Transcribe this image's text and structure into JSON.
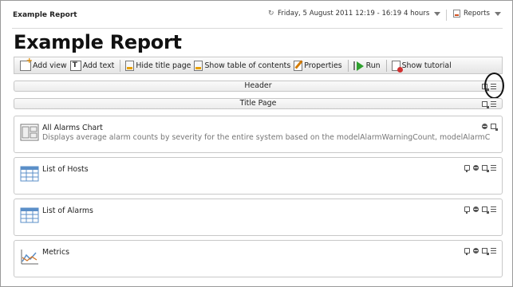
{
  "topbar": {
    "title": "Example Report",
    "time_range": "Friday, 5 August 2011 12:19 - 16:19 4 hours",
    "time_icon": "refresh-clock-icon",
    "reports_label": "Reports",
    "reports_icon": "reports-icon"
  },
  "page": {
    "title": "Example Report"
  },
  "toolbar": {
    "add_view": "Add view",
    "add_text": "Add text",
    "hide_title_page": "Hide title page",
    "show_toc": "Show table of contents",
    "properties": "Properties",
    "run": "Run",
    "show_tutorial": "Show tutorial"
  },
  "sections": {
    "header": "Header",
    "title_page": "Title Page"
  },
  "views": [
    {
      "title": "All Alarms Chart",
      "description": "Displays average alarm counts by severity for the entire system based on the modelAlarmWarningCount, modelAlarmC",
      "icon": "dashboard-layout-icon"
    },
    {
      "title": "List of Hosts",
      "description": "",
      "icon": "table-grid-icon"
    },
    {
      "title": "List of Alarms",
      "description": "",
      "icon": "table-grid-icon"
    },
    {
      "title": "Metrics",
      "description": "",
      "icon": "line-chart-icon"
    }
  ],
  "colors": {
    "accent_orange": "#e08a00",
    "run_green": "#2ea02e",
    "grid_blue": "#5b8fc8"
  }
}
